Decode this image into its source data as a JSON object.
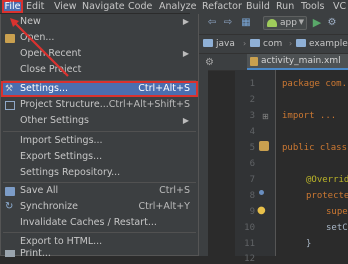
{
  "menubar": {
    "items": [
      "File",
      "Edit",
      "View",
      "Navigate",
      "Code",
      "Analyze",
      "Refactor",
      "Build",
      "Run",
      "Tools",
      "VC"
    ]
  },
  "toolbar": {
    "run_config": "app"
  },
  "breadcrumb": {
    "items": [
      "java",
      "com",
      "example"
    ]
  },
  "editor": {
    "tab": "activity_main.xml",
    "line_numbers": [
      "1",
      "2",
      "3",
      "4",
      "5",
      "6",
      "7",
      "8",
      "9",
      "10",
      "11",
      "12"
    ],
    "code": {
      "l1": "package com.",
      "l3": "import ...",
      "l6": "public class",
      "l8": "@Overrid",
      "l9": "protecte",
      "l10": "supe",
      "l11": "setC"
    }
  },
  "file_menu": {
    "new": "New",
    "open": "Open...",
    "open_recent": "Open Recent",
    "close_project": "Close Project",
    "settings": "Settings...",
    "settings_shortcut": "Ctrl+Alt+S",
    "project_structure": "Project Structure...",
    "project_structure_shortcut": "Ctrl+Alt+Shift+S",
    "other_settings": "Other Settings",
    "import_settings": "Import Settings...",
    "export_settings": "Export Settings...",
    "settings_repository": "Settings Repository...",
    "save_all": "Save All",
    "save_all_shortcut": "Ctrl+S",
    "synchronize": "Synchronize",
    "synchronize_shortcut": "Ctrl+Alt+Y",
    "invalidate_caches": "Invalidate Caches / Restart...",
    "export_html": "Export to HTML...",
    "print": "Print..."
  },
  "colors": {
    "highlight": "#4b6eaf",
    "annotation_red": "#d9322f",
    "menu_bg": "#3c3f41",
    "editor_bg": "#2b2b2b"
  }
}
